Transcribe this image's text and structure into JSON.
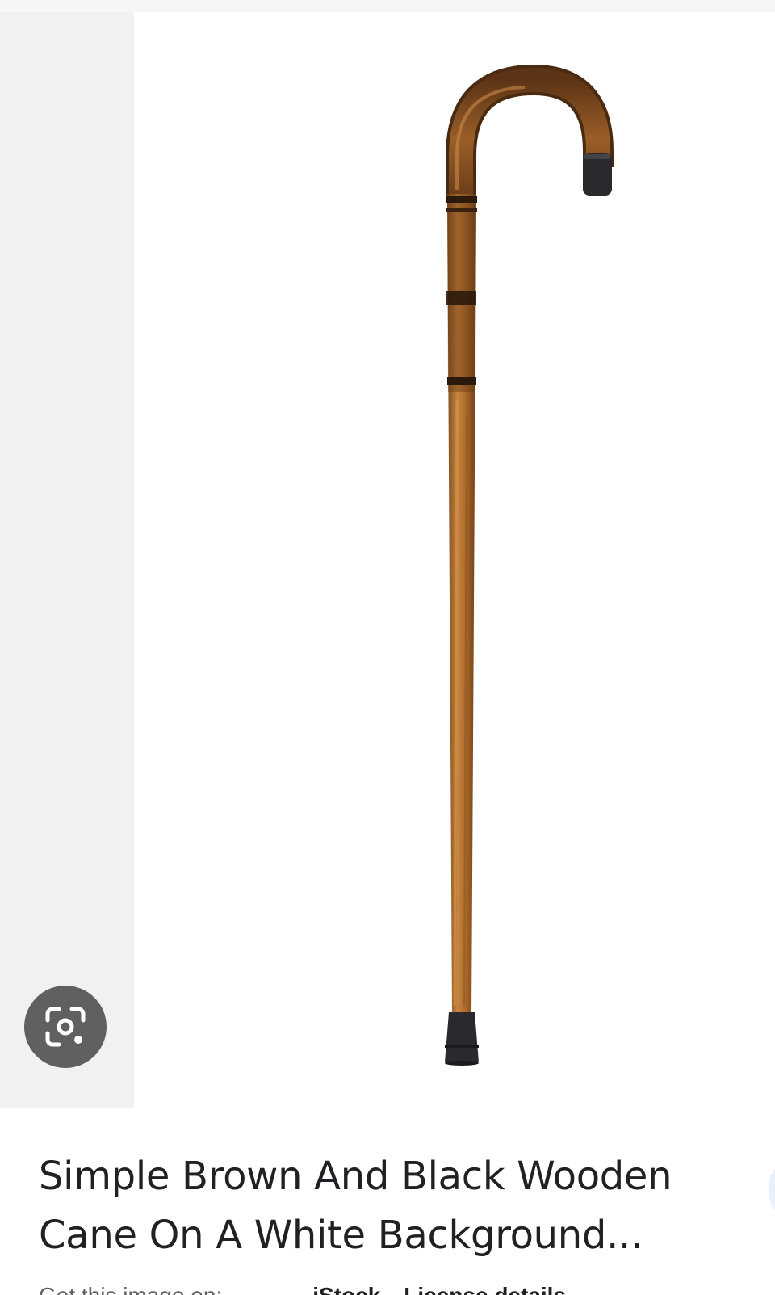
{
  "result": {
    "title": "Simple Brown And Black Wooden Cane On A White Background...",
    "image_alt": "brown and black wooden cane",
    "get_image_prefix": "Get this image on:",
    "source_name": "iStock",
    "license_label": "License details"
  },
  "colors": {
    "panel_bg": "#f0f1f3",
    "lens_button_bg": "#5f6061",
    "title_text": "#202124",
    "cane_wood": "#b5712c",
    "cane_dark": "#2a2a2e"
  },
  "icons": {
    "lens": "google-lens-icon"
  }
}
